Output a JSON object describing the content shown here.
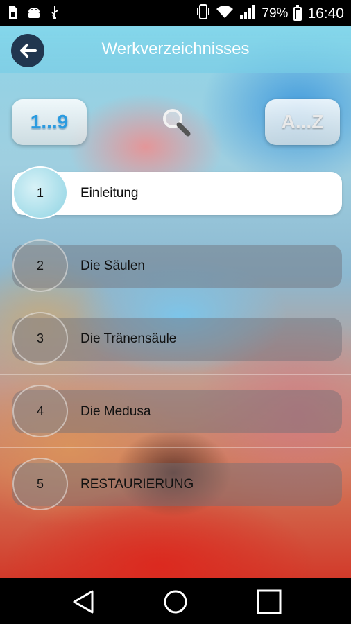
{
  "status_bar": {
    "battery_percent": "79%",
    "time": "16:40",
    "icons": [
      "sim-icon",
      "android-icon",
      "usb-icon",
      "vibrate-icon",
      "wifi-icon",
      "signal-icon",
      "battery-icon"
    ]
  },
  "header": {
    "title": "Werkverzeichnisses",
    "back_icon": "arrow-left-icon"
  },
  "toolbar": {
    "sort_numeric_label": "1...9",
    "sort_alpha_label": "A...Z",
    "search_icon": "magnifier-icon"
  },
  "list": {
    "items": [
      {
        "number": "1",
        "label": "Einleitung",
        "active": true
      },
      {
        "number": "2",
        "label": "Die Säulen",
        "active": false
      },
      {
        "number": "3",
        "label": "Die Tränensäule",
        "active": false
      },
      {
        "number": "4",
        "label": "Die Medusa",
        "active": false
      },
      {
        "number": "5",
        "label": "RESTAURIERUNG",
        "active": false
      }
    ]
  },
  "nav_bar": {
    "icons": [
      "back-triangle-icon",
      "home-circle-icon",
      "recents-square-icon"
    ]
  }
}
